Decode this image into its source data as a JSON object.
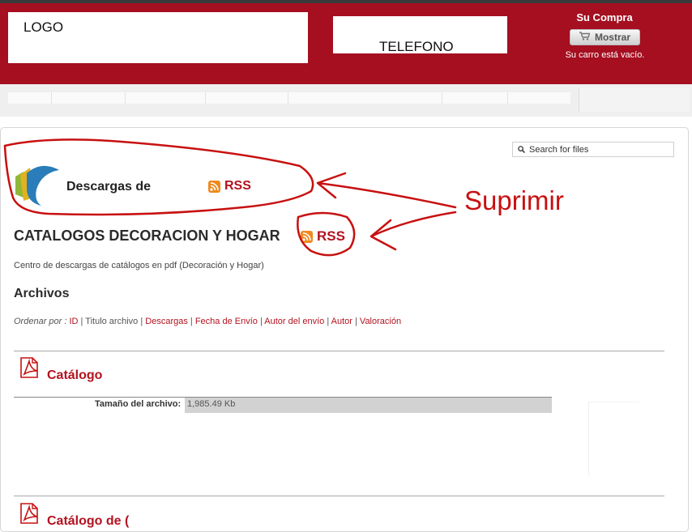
{
  "header": {
    "logo_text": "LOGO",
    "phone_text": "TELEFONO",
    "cart": {
      "title": "Su Compra",
      "button_label": "Mostrar",
      "status": "Su carro está vacío."
    }
  },
  "search": {
    "placeholder": "Search for files",
    "icon": "search-icon"
  },
  "downloads": {
    "title": "Descargas de",
    "rss_label": "RSS"
  },
  "category": {
    "title": "CATALOGOS DECORACION Y HOGAR",
    "rss_label": "RSS",
    "description": "Centro de descargas de catálogos en pdf (Decoración y Hogar)"
  },
  "annotation": {
    "label": "Suprimir",
    "color": "#c81010"
  },
  "files": {
    "heading": "Archivos",
    "sort": {
      "label": "Ordenar por :",
      "options": [
        "ID",
        "Titulo archivo",
        "Descargas",
        "Fecha de Envío",
        "Autor del envío",
        "Autor",
        "Valoración"
      ]
    },
    "items": [
      {
        "name": "Catálogo",
        "size_label": "Tamaño del archivo:",
        "size_value": "1,985.49 Kb",
        "icon": "pdf-icon"
      },
      {
        "name": "Catálogo de (",
        "icon": "pdf-icon"
      }
    ]
  },
  "colors": {
    "brand": "#a50f20",
    "link": "#b3121f",
    "rss": "#ef8a1e"
  }
}
